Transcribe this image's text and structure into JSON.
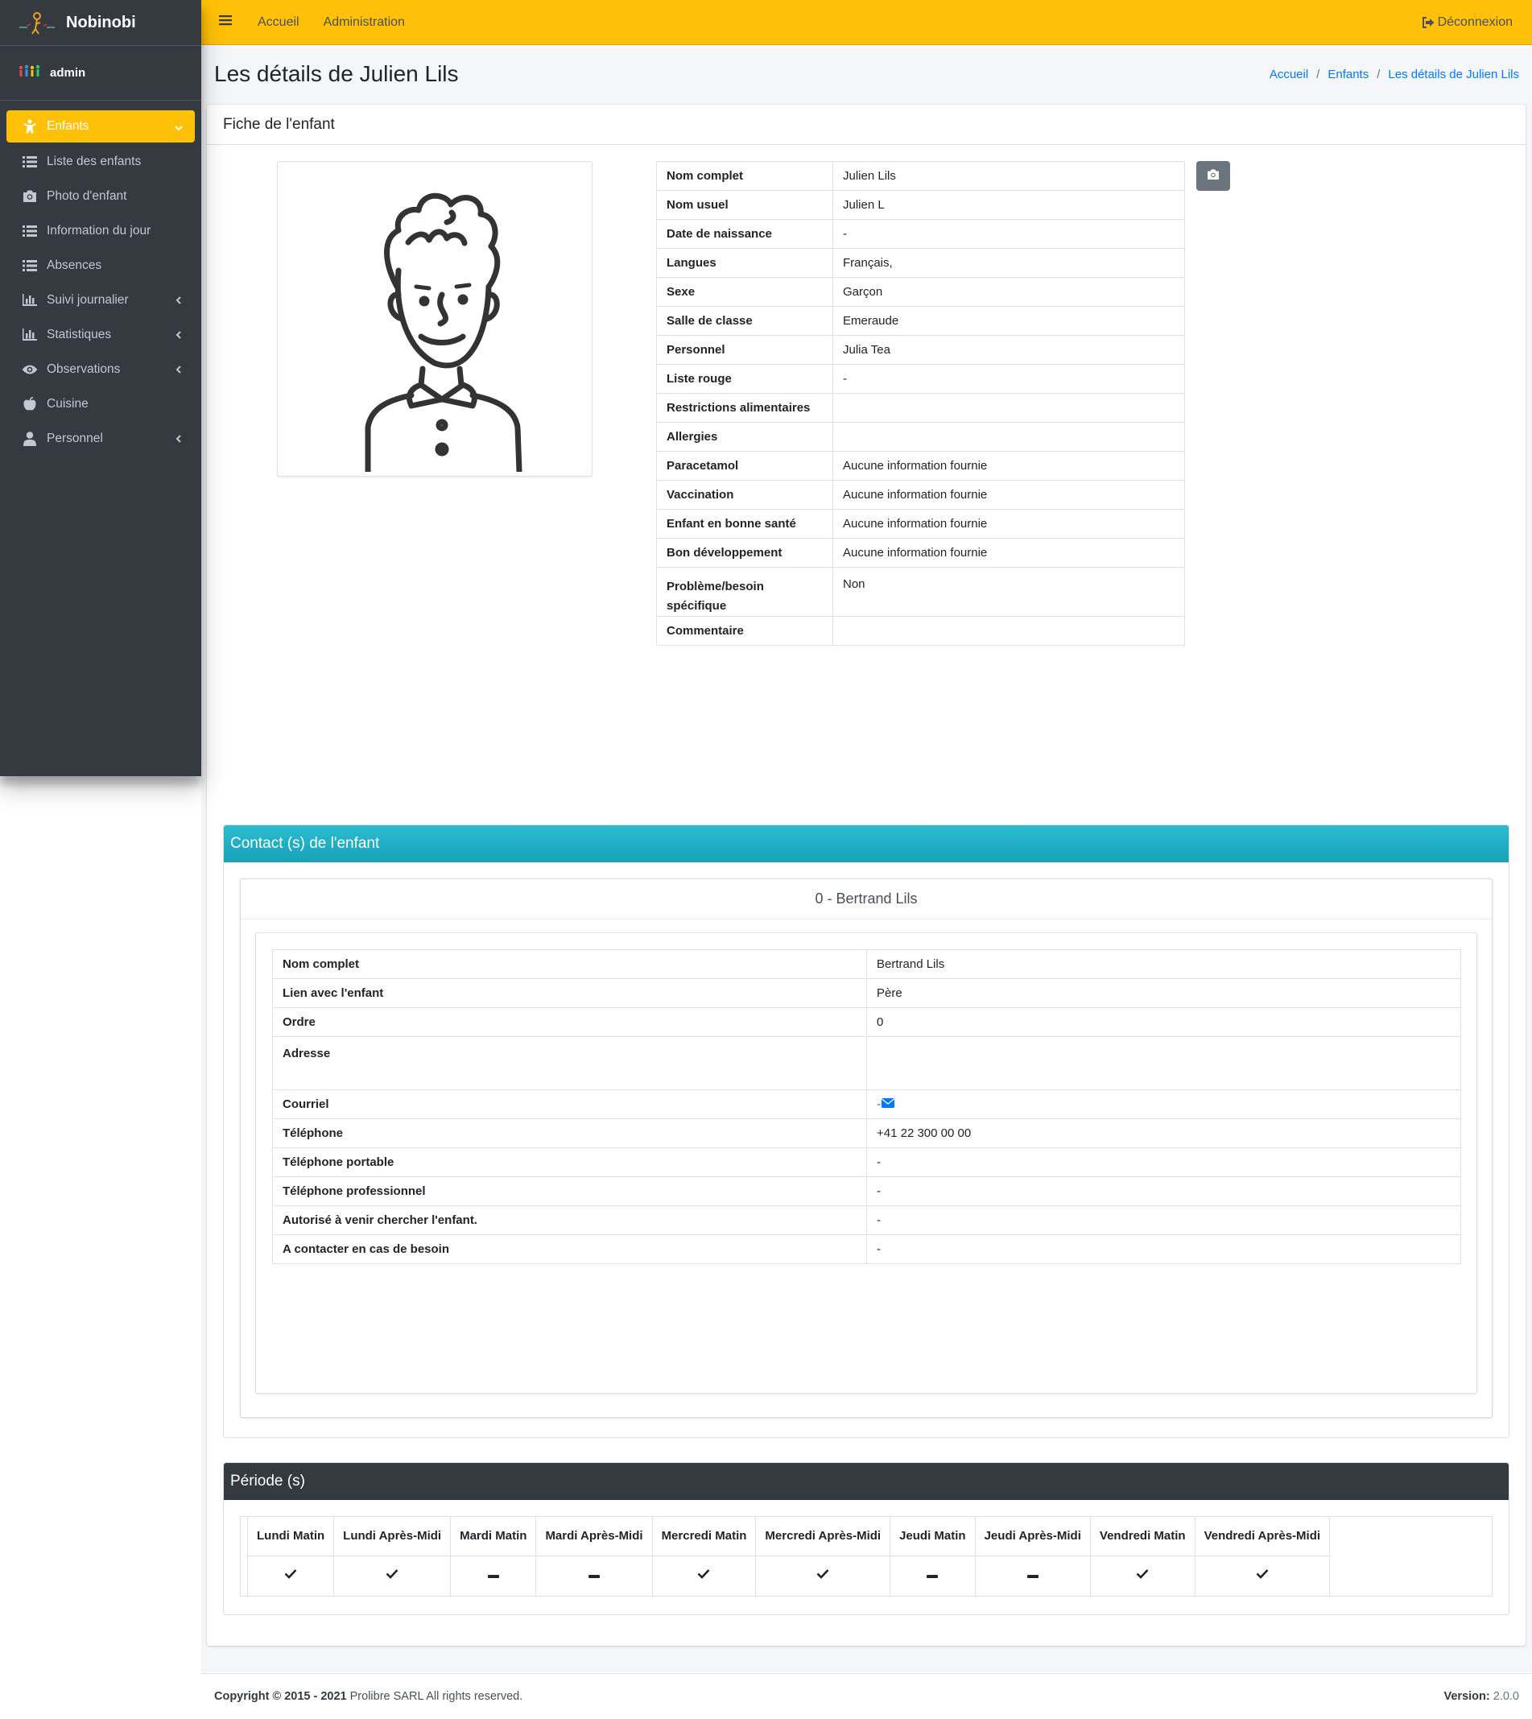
{
  "brand": {
    "name": "Nobinobi"
  },
  "user": {
    "name": "admin"
  },
  "sidebar": {
    "items": [
      {
        "label": "Enfants",
        "icon": "child-icon",
        "active": true
      },
      {
        "label": "Liste des enfants",
        "icon": "list-icon"
      },
      {
        "label": "Photo d'enfant",
        "icon": "camera-icon"
      },
      {
        "label": "Information du jour",
        "icon": "list-icon"
      },
      {
        "label": "Absences",
        "icon": "list-icon"
      },
      {
        "label": "Suivi journalier",
        "icon": "chart-icon"
      },
      {
        "label": "Statistiques",
        "icon": "chart-icon"
      },
      {
        "label": "Observations",
        "icon": "eye-icon"
      },
      {
        "label": "Cuisine",
        "icon": "apple-icon"
      },
      {
        "label": "Personnel",
        "icon": "user-icon"
      }
    ]
  },
  "topbar": {
    "home": "Accueil",
    "admin": "Administration",
    "logout": "Déconnexion"
  },
  "page": {
    "title": "Les détails de Julien Lils",
    "breadcrumb": [
      "Accueil",
      "Enfants",
      "Les détails de Julien Lils"
    ]
  },
  "card": {
    "title": "Fiche de l'enfant"
  },
  "child": {
    "rows": [
      {
        "label": "Nom complet",
        "value": "Julien Lils"
      },
      {
        "label": "Nom usuel",
        "value": "Julien L"
      },
      {
        "label": "Date de naissance",
        "value": "-"
      },
      {
        "label": "Langues",
        "value": "Français,"
      },
      {
        "label": "Sexe",
        "value": "Garçon"
      },
      {
        "label": "Salle de classe",
        "value": "Emeraude"
      },
      {
        "label": "Personnel",
        "value": "Julia Tea"
      },
      {
        "label": "Liste rouge",
        "value": "-"
      },
      {
        "label": "Restrictions alimentaires",
        "value": ""
      },
      {
        "label": "Allergies",
        "value": ""
      },
      {
        "label": "Paracetamol",
        "value": "Aucune information fournie"
      },
      {
        "label": "Vaccination",
        "value": "Aucune information fournie"
      },
      {
        "label": "Enfant en bonne santé",
        "value": "Aucune information fournie"
      },
      {
        "label": "Bon développement",
        "value": "Aucune information fournie"
      },
      {
        "label": "Problème/besoin spécifique",
        "value": "Non"
      },
      {
        "label": "Commentaire",
        "value": ""
      }
    ]
  },
  "contacts": {
    "section_title": "Contact (s) de l'enfant",
    "contact_title": "0 - Bertrand Lils",
    "rows": [
      {
        "label": "Nom complet",
        "value": "Bertrand Lils"
      },
      {
        "label": "Lien avec l'enfant",
        "value": "Père"
      },
      {
        "label": "Ordre",
        "value": "0"
      },
      {
        "label": "Adresse",
        "value": ""
      },
      {
        "label": "Courriel",
        "value": "-"
      },
      {
        "label": "Téléphone",
        "value": "+41 22 300 00 00"
      },
      {
        "label": "Téléphone portable",
        "value": "-"
      },
      {
        "label": "Téléphone professionnel",
        "value": "-"
      },
      {
        "label": "Autorisé à venir chercher l'enfant.",
        "value": "-"
      },
      {
        "label": "A contacter en cas de besoin",
        "value": "-"
      }
    ]
  },
  "periods": {
    "section_title": "Période (s)",
    "columns": [
      "Lundi Matin",
      "Lundi Après-Midi",
      "Mardi Matin",
      "Mardi Après-Midi",
      "Mercredi Matin",
      "Mercredi Après-Midi",
      "Jeudi Matin",
      "Jeudi Après-Midi",
      "Vendredi Matin",
      "Vendredi Après-Midi"
    ],
    "values": [
      "check",
      "check",
      "minus",
      "minus",
      "check",
      "check",
      "minus",
      "minus",
      "check",
      "check"
    ]
  },
  "footer": {
    "copyright_bold": "Copyright © 2015 - 2021",
    "copyright_rest": "Prolibre SARL All rights reserved.",
    "version_label": "Version:",
    "version_value": "2.0.0"
  },
  "colors": {
    "accent": "#ffc107",
    "sidebar": "#343a40",
    "contact_header": "#17a2b8",
    "link": "#007bff"
  }
}
